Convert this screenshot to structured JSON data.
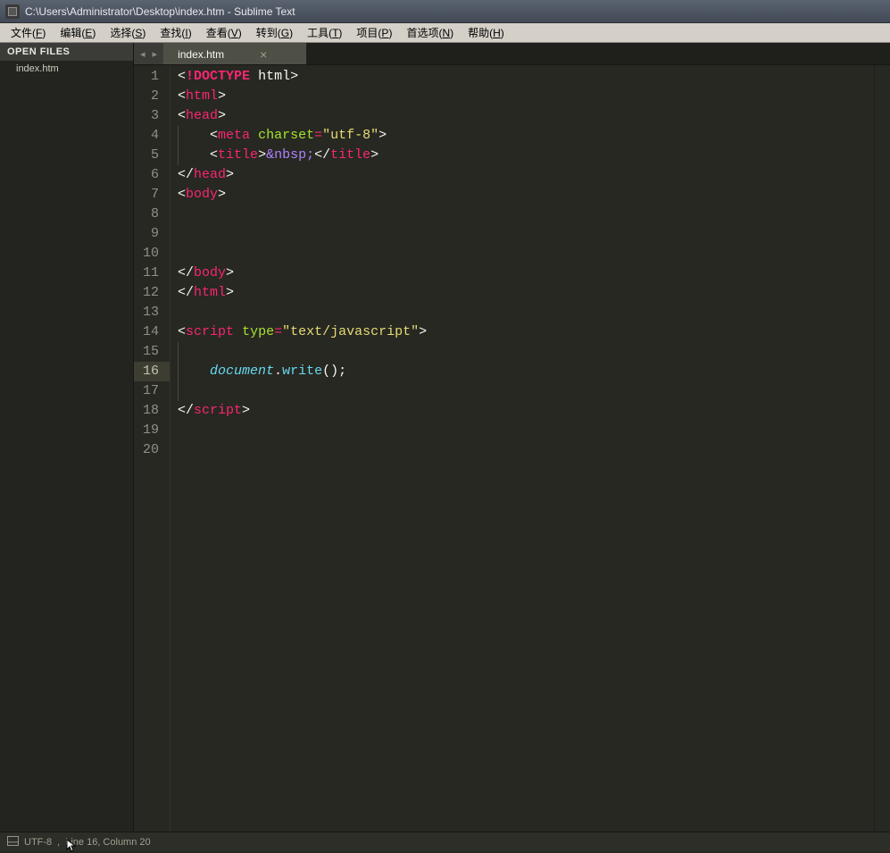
{
  "window": {
    "title": "C:\\Users\\Administrator\\Desktop\\index.htm - Sublime Text"
  },
  "menu": [
    {
      "label": "文件",
      "mnemonic": "F"
    },
    {
      "label": "编辑",
      "mnemonic": "E"
    },
    {
      "label": "选择",
      "mnemonic": "S"
    },
    {
      "label": "查找",
      "mnemonic": "I"
    },
    {
      "label": "查看",
      "mnemonic": "V"
    },
    {
      "label": "转到",
      "mnemonic": "G"
    },
    {
      "label": "工具",
      "mnemonic": "T"
    },
    {
      "label": "项目",
      "mnemonic": "P"
    },
    {
      "label": "首选项",
      "mnemonic": "N"
    },
    {
      "label": "帮助",
      "mnemonic": "H"
    }
  ],
  "sidebar": {
    "header": "OPEN FILES",
    "files": [
      {
        "name": "index.htm"
      }
    ]
  },
  "tabs": {
    "active": {
      "label": "index.htm"
    }
  },
  "code": {
    "lines": [
      [
        {
          "t": "bracket",
          "v": "<"
        },
        {
          "t": "doctype",
          "v": "!DOCTYPE"
        },
        {
          "t": "plain",
          "v": " "
        },
        {
          "t": "doctype-name",
          "v": "html"
        },
        {
          "t": "bracket",
          "v": ">"
        }
      ],
      [
        {
          "t": "bracket",
          "v": "<"
        },
        {
          "t": "tag",
          "v": "html"
        },
        {
          "t": "bracket",
          "v": ">"
        }
      ],
      [
        {
          "t": "bracket",
          "v": "<"
        },
        {
          "t": "tag",
          "v": "head"
        },
        {
          "t": "bracket",
          "v": ">"
        }
      ],
      [
        {
          "t": "plain",
          "v": "    "
        },
        {
          "t": "bracket",
          "v": "<"
        },
        {
          "t": "tag",
          "v": "meta"
        },
        {
          "t": "plain",
          "v": " "
        },
        {
          "t": "attr",
          "v": "charset"
        },
        {
          "t": "op",
          "v": "="
        },
        {
          "t": "string",
          "v": "\"utf-8\""
        },
        {
          "t": "bracket",
          "v": ">"
        }
      ],
      [
        {
          "t": "plain",
          "v": "    "
        },
        {
          "t": "bracket",
          "v": "<"
        },
        {
          "t": "tag",
          "v": "title"
        },
        {
          "t": "bracket",
          "v": ">"
        },
        {
          "t": "entity",
          "v": "&nbsp;"
        },
        {
          "t": "bracket",
          "v": "</"
        },
        {
          "t": "tag",
          "v": "title"
        },
        {
          "t": "bracket",
          "v": ">"
        }
      ],
      [
        {
          "t": "bracket",
          "v": "</"
        },
        {
          "t": "tag",
          "v": "head"
        },
        {
          "t": "bracket",
          "v": ">"
        }
      ],
      [
        {
          "t": "bracket",
          "v": "<"
        },
        {
          "t": "tag",
          "v": "body"
        },
        {
          "t": "bracket",
          "v": ">"
        }
      ],
      [],
      [],
      [],
      [
        {
          "t": "bracket",
          "v": "</"
        },
        {
          "t": "tag",
          "v": "body"
        },
        {
          "t": "bracket",
          "v": ">"
        }
      ],
      [
        {
          "t": "bracket",
          "v": "</"
        },
        {
          "t": "tag",
          "v": "html"
        },
        {
          "t": "bracket",
          "v": ">"
        }
      ],
      [],
      [
        {
          "t": "bracket",
          "v": "<"
        },
        {
          "t": "tag",
          "v": "script"
        },
        {
          "t": "plain",
          "v": " "
        },
        {
          "t": "attr",
          "v": "type"
        },
        {
          "t": "op",
          "v": "="
        },
        {
          "t": "string",
          "v": "\"text/javascript\""
        },
        {
          "t": "bracket",
          "v": ">"
        }
      ],
      [
        {
          "t": "plain",
          "v": "    "
        }
      ],
      [
        {
          "t": "plain",
          "v": "    "
        },
        {
          "t": "var-italic",
          "v": "document"
        },
        {
          "t": "punct",
          "v": "."
        },
        {
          "t": "func",
          "v": "write"
        },
        {
          "t": "punct",
          "v": "();"
        }
      ],
      [
        {
          "t": "plain",
          "v": "    "
        }
      ],
      [
        {
          "t": "bracket",
          "v": "</"
        },
        {
          "t": "tag",
          "v": "script"
        },
        {
          "t": "bracket",
          "v": ">"
        }
      ],
      [],
      []
    ],
    "current_line": 16
  },
  "status": {
    "encoding": "UTF-8",
    "position": "Line 16, Column 20"
  }
}
